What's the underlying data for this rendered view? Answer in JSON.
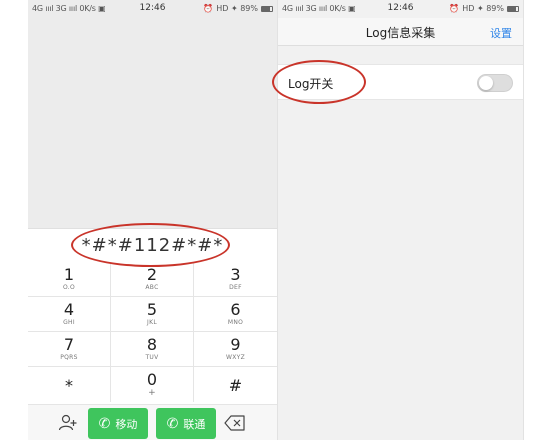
{
  "left_screen": {
    "status_bar": {
      "left": "4G ıııl 3G ıııl 0K/s ▣",
      "time": "12:46",
      "right": "HD ✦ 89%"
    },
    "dialed_number": "*#*#112#*#*",
    "keys": [
      {
        "digit": "1",
        "letters": "O.O"
      },
      {
        "digit": "2",
        "letters": "ABC"
      },
      {
        "digit": "3",
        "letters": "DEF"
      },
      {
        "digit": "4",
        "letters": "GHI"
      },
      {
        "digit": "5",
        "letters": "JKL"
      },
      {
        "digit": "6",
        "letters": "MNO"
      },
      {
        "digit": "7",
        "letters": "PQRS"
      },
      {
        "digit": "8",
        "letters": "TUV"
      },
      {
        "digit": "9",
        "letters": "WXYZ"
      },
      {
        "digit": "*",
        "letters": ""
      },
      {
        "digit": "0",
        "letters": "+"
      },
      {
        "digit": "#",
        "letters": ""
      }
    ],
    "call_buttons": [
      {
        "label": "移动"
      },
      {
        "label": "联通"
      }
    ],
    "colors": {
      "call_button": "#3fc55d",
      "annotation": "#c9342a"
    }
  },
  "right_screen": {
    "status_bar": {
      "left": "4G ıııl 3G ıııl 0K/s ▣",
      "time": "12:46",
      "right": "HD ✦ 89%"
    },
    "title": "Log信息采集",
    "action": "设置",
    "setting": {
      "label": "Log开关",
      "enabled": false
    },
    "colors": {
      "action_link": "#2f85e8"
    }
  }
}
